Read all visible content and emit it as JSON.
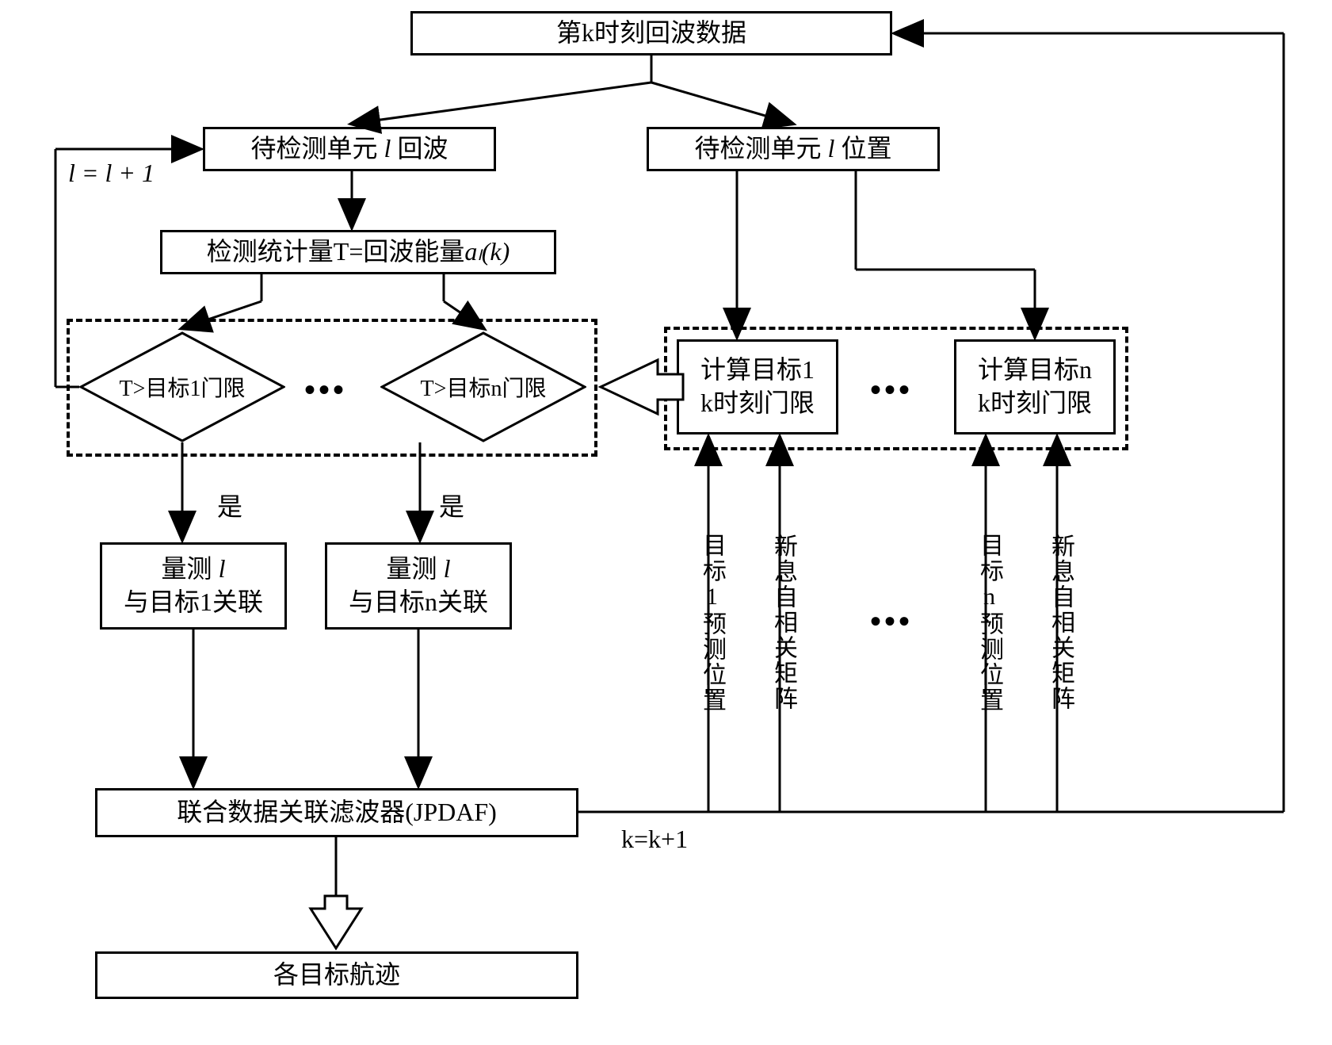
{
  "top": {
    "title": "第k时刻回波数据"
  },
  "left_branch": {
    "unit_echo_prefix": "待检测单元 ",
    "unit_echo_var": "l",
    "unit_echo_suffix": " 回波",
    "increment": "l = l + 1",
    "stat_prefix": "检测统计量T=回波能量",
    "stat_formula": "aₗ(k)",
    "diamond1": "T>目标1门限",
    "diamondn": "T>目标n门限",
    "yes1": "是",
    "yesn": "是",
    "assoc1_l1": "量测 l",
    "assoc1_l2": "与目标1关联",
    "assocn_l1": "量测 l",
    "assocn_l2": "与目标n关联",
    "jpdaf": "联合数据关联滤波器(JPDAF)",
    "tracks": "各目标航迹",
    "k_inc": "k=k+1"
  },
  "right_branch": {
    "unit_pos_prefix": "待检测单元 ",
    "unit_pos_var": "l",
    "unit_pos_suffix": " 位置",
    "calc1_l1": "计算目标1",
    "calc1_l2": "k时刻门限",
    "calcn_l1": "计算目标n",
    "calcn_l2": "k时刻门限",
    "v1": "目标1预测位置",
    "v2": "新息自相关矩阵",
    "v3": "目标n预测位置",
    "v4": "新息自相关矩阵"
  },
  "dots": "•••"
}
